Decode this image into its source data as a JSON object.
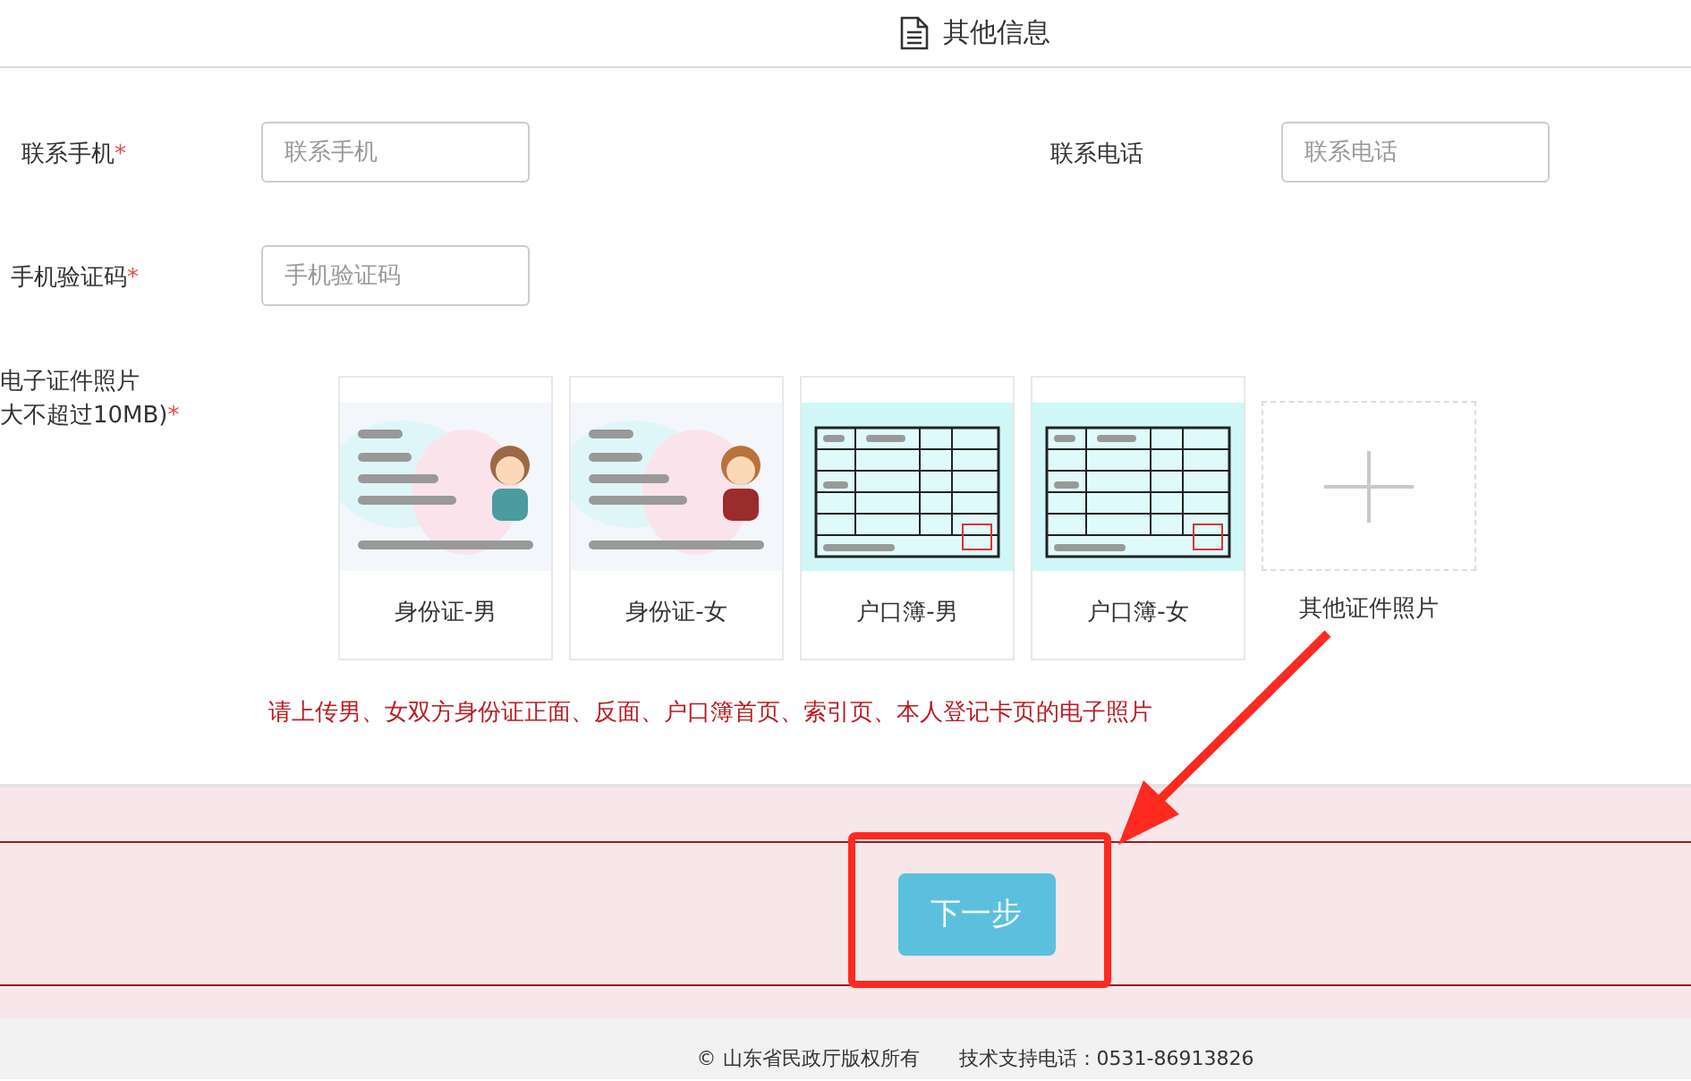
{
  "header": {
    "title": "其他信息"
  },
  "fields": [
    {
      "label": "联系手机",
      "required_mark": "*",
      "placeholder": "联系手机"
    },
    {
      "label": "联系电话",
      "placeholder": "联系电话"
    },
    {
      "label": "手机验证码",
      "required_mark": "*",
      "placeholder": "手机验证码"
    }
  ],
  "photos": {
    "label_lines": [
      "电子证件照片",
      "大不超过10MB)"
    ],
    "required_mark": "*",
    "cards": [
      {
        "kind": "id_male",
        "caption": "身份证-男"
      },
      {
        "kind": "id_female",
        "caption": "身份证-女"
      },
      {
        "kind": "household",
        "caption": "户口簿-男"
      },
      {
        "kind": "household",
        "caption": "户口簿-女"
      },
      {
        "kind": "add",
        "caption": "其他证件照片"
      }
    ],
    "notice": "请上传男、女双方身份证正面、反面、户口簿首页、索引页、本人登记卡页的电子照片"
  },
  "next_button": "下一步",
  "footer": [
    "© 山东省民政厅版权所有",
    "技术支持电话：0531-86913826"
  ]
}
